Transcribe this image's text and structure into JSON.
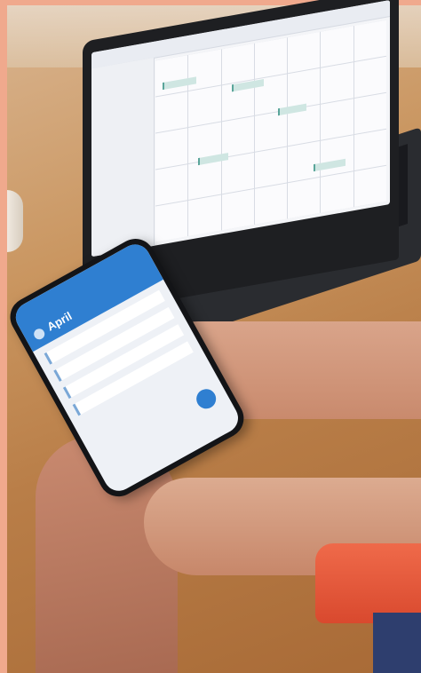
{
  "phone_app": {
    "month_title": "April"
  },
  "scene": {
    "colors": {
      "border": "#f0a98d",
      "table": "#c9955f",
      "phone_header": "#2f7fd1",
      "sleeve": "#ef6a4a"
    }
  }
}
